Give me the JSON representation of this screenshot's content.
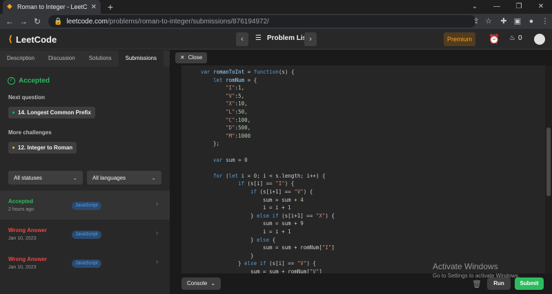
{
  "browser": {
    "tab_title": "Roman to Integer - LeetCode",
    "url_host": "leetcode.com",
    "url_path": "/problems/roman-to-integer/submissions/876194972/"
  },
  "nav": {
    "logo": "LeetCode",
    "problem_list": "Problem List",
    "premium": "Premium",
    "streak": "0"
  },
  "left_tabs": [
    "Description",
    "Discussion",
    "Solutions",
    "Submissions"
  ],
  "result": {
    "status": "Accepted",
    "next_question_heading": "Next question",
    "next_question": "14. Longest Common Prefix",
    "more_challenges_heading": "More challenges",
    "more_challenge": "12. Integer to Roman"
  },
  "filters": {
    "status": "All statuses",
    "language": "All languages"
  },
  "submissions": [
    {
      "status": "Accepted",
      "date": "2 hours ago",
      "lang": "JavaScript",
      "color": "#2cbb5d"
    },
    {
      "status": "Wrong Answer",
      "date": "Jan 10, 2023",
      "lang": "JavaScript",
      "color": "#ef4743"
    },
    {
      "status": "Wrong Answer",
      "date": "Jan 10, 2023",
      "lang": "JavaScript",
      "color": "#ef4743"
    }
  ],
  "editor": {
    "close_label": "Close",
    "console_label": "Console",
    "run_label": "Run",
    "submit_label": "Submit"
  },
  "code": [
    {
      "indent": 0,
      "tokens": [
        [
          "kw",
          "var "
        ],
        [
          "var",
          "romanToInt"
        ],
        [
          "op",
          " = "
        ],
        [
          "kw",
          "function"
        ],
        [
          "op",
          "(s) {"
        ]
      ]
    },
    {
      "indent": 1,
      "tokens": [
        [
          "kw",
          "let "
        ],
        [
          "var",
          "romNum"
        ],
        [
          "op",
          " = {"
        ]
      ]
    },
    {
      "indent": 2,
      "tokens": [
        [
          "str",
          "\"I\""
        ],
        [
          "op",
          ":"
        ],
        [
          "num",
          "1"
        ],
        [
          "op",
          ","
        ]
      ]
    },
    {
      "indent": 2,
      "tokens": [
        [
          "str",
          "\"V\""
        ],
        [
          "op",
          ":"
        ],
        [
          "num",
          "5"
        ],
        [
          "op",
          ","
        ]
      ]
    },
    {
      "indent": 2,
      "tokens": [
        [
          "str",
          "\"X\""
        ],
        [
          "op",
          ":"
        ],
        [
          "num",
          "10"
        ],
        [
          "op",
          ","
        ]
      ]
    },
    {
      "indent": 2,
      "tokens": [
        [
          "str",
          "\"L\""
        ],
        [
          "op",
          ":"
        ],
        [
          "num",
          "50"
        ],
        [
          "op",
          ","
        ]
      ]
    },
    {
      "indent": 2,
      "tokens": [
        [
          "str",
          "\"C\""
        ],
        [
          "op",
          ":"
        ],
        [
          "num",
          "100"
        ],
        [
          "op",
          ","
        ]
      ]
    },
    {
      "indent": 2,
      "tokens": [
        [
          "str",
          "\"D\""
        ],
        [
          "op",
          ":"
        ],
        [
          "num",
          "500"
        ],
        [
          "op",
          ","
        ]
      ]
    },
    {
      "indent": 2,
      "tokens": [
        [
          "str",
          "\"M\""
        ],
        [
          "op",
          ":"
        ],
        [
          "num",
          "1000"
        ]
      ]
    },
    {
      "indent": 1,
      "tokens": [
        [
          "op",
          "};"
        ]
      ]
    },
    {
      "indent": 0,
      "tokens": []
    },
    {
      "indent": 1,
      "tokens": [
        [
          "kw",
          "var "
        ],
        [
          "var",
          "sum"
        ],
        [
          "op",
          " = "
        ],
        [
          "num",
          "0"
        ]
      ]
    },
    {
      "indent": 0,
      "tokens": []
    },
    {
      "indent": 1,
      "tokens": [
        [
          "kw",
          "for "
        ],
        [
          "op",
          "("
        ],
        [
          "kw",
          "let "
        ],
        [
          "var",
          "i"
        ],
        [
          "op",
          " = "
        ],
        [
          "num",
          "0"
        ],
        [
          "op",
          "; i < s.length; i++) {"
        ]
      ]
    },
    {
      "indent": 3,
      "tokens": [
        [
          "kw",
          "if "
        ],
        [
          "op",
          "(s[i] == "
        ],
        [
          "str",
          "\"I\""
        ],
        [
          "op",
          ") {"
        ]
      ]
    },
    {
      "indent": 4,
      "tokens": [
        [
          "kw",
          "if "
        ],
        [
          "op",
          "(s[i+1] == "
        ],
        [
          "str",
          "\"V\""
        ],
        [
          "op",
          ") {"
        ]
      ]
    },
    {
      "indent": 5,
      "tokens": [
        [
          "op",
          "sum = sum + "
        ],
        [
          "num",
          "4"
        ]
      ]
    },
    {
      "indent": 5,
      "tokens": [
        [
          "op",
          "i = i + "
        ],
        [
          "num",
          "1"
        ]
      ]
    },
    {
      "indent": 4,
      "tokens": [
        [
          "op",
          "} "
        ],
        [
          "kw",
          "else if "
        ],
        [
          "op",
          "(s[i+1] == "
        ],
        [
          "str",
          "\"X\""
        ],
        [
          "op",
          ") {"
        ]
      ]
    },
    {
      "indent": 5,
      "tokens": [
        [
          "op",
          "sum = sum + "
        ],
        [
          "num",
          "9"
        ]
      ]
    },
    {
      "indent": 5,
      "tokens": [
        [
          "op",
          "i = i + "
        ],
        [
          "num",
          "1"
        ]
      ]
    },
    {
      "indent": 4,
      "tokens": [
        [
          "op",
          "} "
        ],
        [
          "kw",
          "else "
        ],
        [
          "op",
          "{"
        ]
      ]
    },
    {
      "indent": 5,
      "tokens": [
        [
          "op",
          "sum = sum + romNum["
        ],
        [
          "str",
          "\"I\""
        ],
        [
          "op",
          "]"
        ]
      ]
    },
    {
      "indent": 4,
      "tokens": [
        [
          "op",
          "}"
        ]
      ]
    },
    {
      "indent": 3,
      "tokens": [
        [
          "op",
          "} "
        ],
        [
          "kw",
          "else if "
        ],
        [
          "op",
          "(s[i] == "
        ],
        [
          "str",
          "\"V\""
        ],
        [
          "op",
          ") {"
        ]
      ]
    },
    {
      "indent": 4,
      "tokens": [
        [
          "op",
          "sum = sum + romNum["
        ],
        [
          "str",
          "\"V\""
        ],
        [
          "op",
          "]"
        ]
      ]
    }
  ],
  "watermark": {
    "line1": "Activate Windows",
    "line2": "Go to Settings to activate Windows."
  }
}
